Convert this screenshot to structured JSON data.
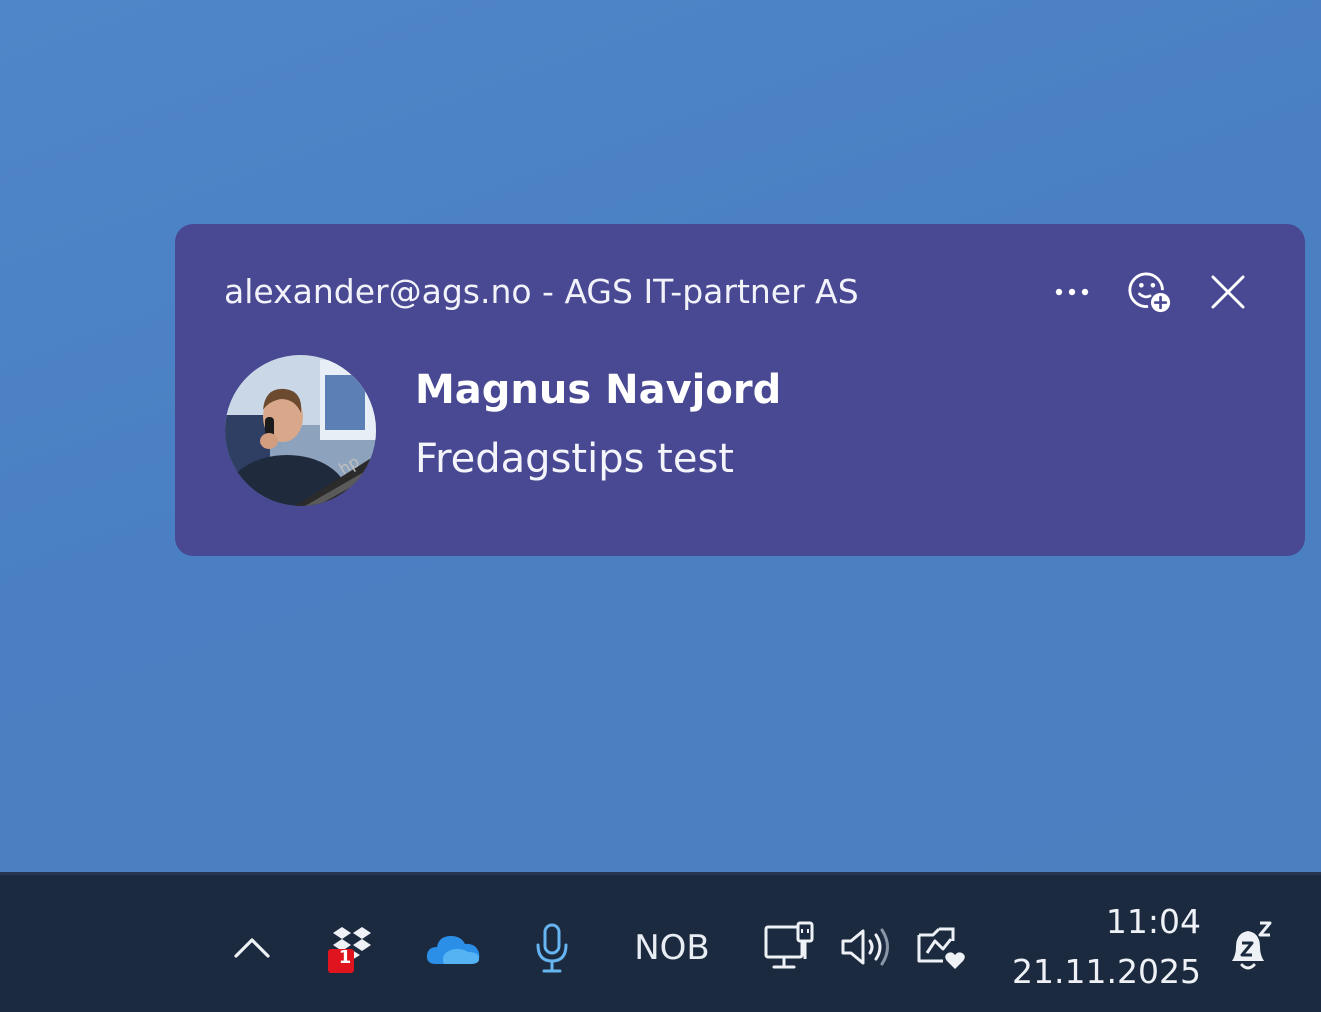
{
  "notification": {
    "account": "alexander@ags.no - AGS IT-partner AS",
    "sender": "Magnus Navjord",
    "message": "Fredagstips test",
    "background_color": "#484893",
    "icons": {
      "more": "more-options-icon",
      "reaction": "add-reaction-icon",
      "close": "close-icon"
    }
  },
  "taskbar": {
    "language": "NOB",
    "time": "11:04",
    "date": "21.11.2025",
    "dropbox_badge": "1",
    "icons": [
      "chevron-up-icon",
      "dropbox-icon",
      "onedrive-icon",
      "microphone-icon",
      "network-icon",
      "speaker-icon",
      "battery-saver-icon",
      "notification-bell-snooze-icon"
    ],
    "background_color": "#1c2a40"
  }
}
